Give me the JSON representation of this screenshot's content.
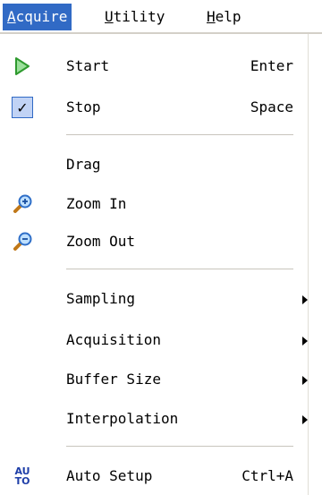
{
  "menubar": {
    "items": [
      {
        "label": "Acquire",
        "mnemonic": "A",
        "rest": "cquire"
      },
      {
        "label": "Utility",
        "mnemonic": "U",
        "rest": "tility"
      },
      {
        "label": "Help",
        "mnemonic": "H",
        "rest": "elp"
      }
    ],
    "active_color": "#316ac5"
  },
  "menu": {
    "start": {
      "label": "Start",
      "shortcut": "Enter",
      "icon": "play-icon"
    },
    "stop": {
      "label": "Stop",
      "shortcut": "Space",
      "icon": "check-icon",
      "checked": true
    },
    "drag": {
      "label": "Drag"
    },
    "zoom_in": {
      "label": "Zoom In",
      "icon": "zoom-in-icon"
    },
    "zoom_out": {
      "label": "Zoom Out",
      "icon": "zoom-out-icon"
    },
    "sampling": {
      "label": "Sampling"
    },
    "acquisition": {
      "label": "Acquisition"
    },
    "buffer_size": {
      "label": "Buffer Size"
    },
    "interpolation": {
      "label": "Interpolation"
    },
    "auto_setup": {
      "label": "Auto Setup",
      "shortcut": "Ctrl+A",
      "icon": "auto-icon",
      "icon_text_top": "AU",
      "icon_text_bottom": "TO"
    }
  }
}
